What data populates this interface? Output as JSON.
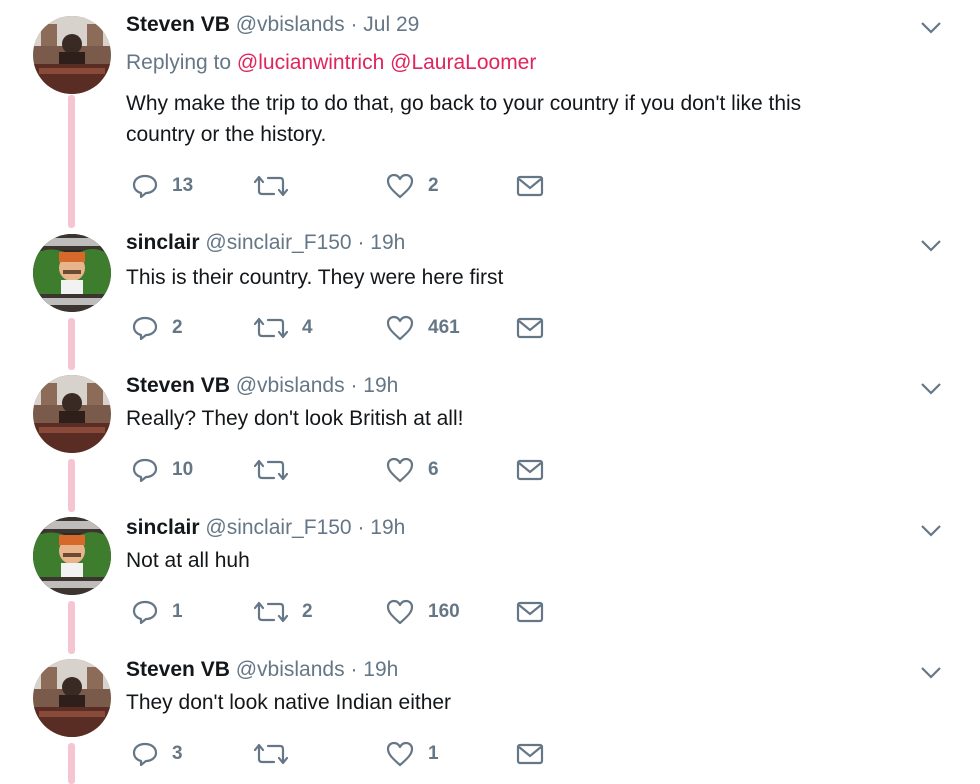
{
  "tweets": [
    {
      "name": "Steven VB",
      "handle": "@vbislands",
      "separator": "·",
      "time": "Jul 29",
      "replying_prefix": "Replying to",
      "mentions": [
        "@lucianwintrich",
        "@LauraLoomer"
      ],
      "text_lines": [
        "Why make the trip to do that, go back to your country if you don't like this",
        "country or the history."
      ],
      "avatar": "steven-avatar",
      "replies": "13",
      "retweets": "",
      "likes": "2"
    },
    {
      "name": "sinclair",
      "handle": "@sinclair_F150",
      "separator": "·",
      "time": "19h",
      "text_lines": [
        "This is their country. They were here first"
      ],
      "avatar": "sinclair-avatar",
      "replies": "2",
      "retweets": "4",
      "likes": "461"
    },
    {
      "name": "Steven VB",
      "handle": "@vbislands",
      "separator": "·",
      "time": "19h",
      "text_lines": [
        "Really? They don't look British at all!"
      ],
      "avatar": "steven-avatar",
      "replies": "10",
      "retweets": "",
      "likes": "6"
    },
    {
      "name": "sinclair",
      "handle": "@sinclair_F150",
      "separator": "·",
      "time": "19h",
      "text_lines": [
        "Not at all huh"
      ],
      "avatar": "sinclair-avatar",
      "replies": "1",
      "retweets": "2",
      "likes": "160"
    },
    {
      "name": "Steven VB",
      "handle": "@vbislands",
      "separator": "·",
      "time": "19h",
      "text_lines": [
        "They don't look native Indian either"
      ],
      "avatar": "steven-avatar",
      "replies": "3",
      "retweets": "",
      "likes": "1"
    }
  ],
  "icons": {
    "reply": "reply-icon",
    "retweet": "retweet-icon",
    "like": "heart-icon",
    "dm": "envelope-icon",
    "menu": "chevron-down-icon"
  },
  "colors": {
    "mention": "#e0245e",
    "thread_line": "#f5c6d1",
    "meta_text": "#657786"
  }
}
